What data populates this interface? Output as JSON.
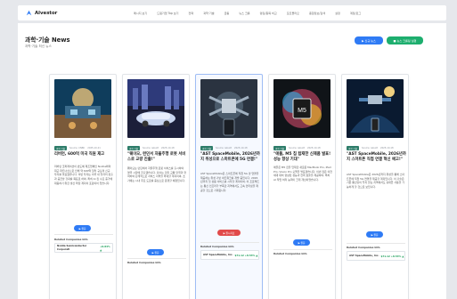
{
  "brand": {
    "name": "Alvestor"
  },
  "nav": [
    {
      "label": "메시지 보기"
    },
    {
      "label": "드림기업 Top 보기"
    },
    {
      "label": "전략"
    },
    {
      "label": "과학·기술"
    },
    {
      "label": "금융"
    },
    {
      "label": "뉴스 크롤"
    },
    {
      "label": "랭킹/종목 비교"
    },
    {
      "label": "포트폴리오"
    },
    {
      "label": "종합정보/검색"
    },
    {
      "label": "설정"
    },
    {
      "label": "계정/로그"
    }
  ],
  "page": {
    "title": "과학·기술 News",
    "subtitle": "과학·기술 최신 뉴스"
  },
  "actions": {
    "new_label": "▶ 신규 뉴스",
    "crawl_label": "■ 뉴스 크롤링 실행"
  },
  "cards": [
    {
      "tag": "과학·기술",
      "source": "Source: CNBC",
      "date": "2025-10-21",
      "title": "리버먼, 600억 미국 직원 재고",
      "body": "리버먼 코퍼레이션이 반도체 제조업체인 Nvidia와의 최근 파트너십으로 인해 약 600억 달러 규모의 신규 투자를 발표했습니다. 이번 투자는 미국 내 일자리 창출과 공급망 강화를 목표로 하며, 특히 AI 칩 수요 증가에 대응하기 위한 생산 확장 계획이 포함되어 있습니다.",
      "button": "▶ 원문",
      "related_label": "Related Companies Info",
      "company": {
        "name": "Nvidia Semiconductor Corporati",
        "change": "+0.84% ▲"
      }
    },
    {
      "tag": "과학·기술",
      "source": "Source: iebuilt",
      "date": "2025-10-18",
      "title": "\"웨이모, 런던서 자율주행 로봇 서비스로 교량 진출!\"",
      "body": "웨이모는 런던에서 자율주행 로봇 서비스를 출시하며 영국 시장에 진출했습니다. 회사는 현지 교통 당국과 협력하여 단계적으로 서비스 지역을 확대할 계획이며, 초기에는 시내 주요 도로를 중심으로 운행할 예정입니다.",
      "button": "▶ 원문",
      "related_label": "Related Companies Info",
      "company": {
        "name": "",
        "change": ""
      }
    },
    {
      "tag": "과학·기술",
      "source": "Source: iebuilt",
      "date": "2025-10-18",
      "title": "\"AST SpaceMobile, 2026년까지 위성으로 스마트폰에 5G 연결!\"",
      "body": "AST SpaceMobile은 스마트폰에 직접 5G 망 연결을 제공하는 위성 기반 네트워크를 개발 중입니다. 2026년까지 첫 상용 서비스를 시작할 계획이며, 이 프로젝트는 통신 인프라가 부족한 지역에서도 고속 인터넷을 제공할 것으로 기대됩니다.",
      "button": "▶ 원시자료",
      "related_label": "Related Companies Info",
      "company": {
        "name": "AST SpaceMobile, Inc.",
        "change": "$71.12 +8.53% ▲"
      }
    },
    {
      "tag": "과학·기술",
      "source": "Source: iebuilt",
      "date": "2025-10-18",
      "title": "\"애플, M5 칩 탑재한 신제품 발표! 성능 향상 기대\"",
      "body": "애플은 M5 칩을 탑재한 새로운 MacBook Pro, iPad Pro, Vision Pro 모델을 발표했습니다. 이번 칩은 이전 세대 대비 향상된 성능과 전력 효율을 제공하며, 특히 AI 작업 처리 능력이 크게 개선되었습니다.",
      "button": "▶ 원문",
      "related_label": "Related Companies Info",
      "company": {
        "name": "",
        "change": ""
      }
    },
    {
      "tag": "과학·기술",
      "source": "Source: iebuilt",
      "date": "2025-10-18",
      "title": "\"AST SpaceMobile, 2026년까지 스마트폰 직접 연결 혁신 예고!\"",
      "body": "AST SpaceMobile은 2026년까지 위성을 통해 스마트폰에 직접 5G 연결을 제공할 계획입니다. 이 기술은 기존 통신망이 닿지 않는 지역에서도 휴대폰 사용을 가능하게 할 것으로 보입니다.",
      "button": "▶ 원문",
      "related_label": "Related Companies Info",
      "company": {
        "name": "AST SpaceMobile, Inc.",
        "change": "$71.12 +8.53% ▲"
      }
    }
  ]
}
